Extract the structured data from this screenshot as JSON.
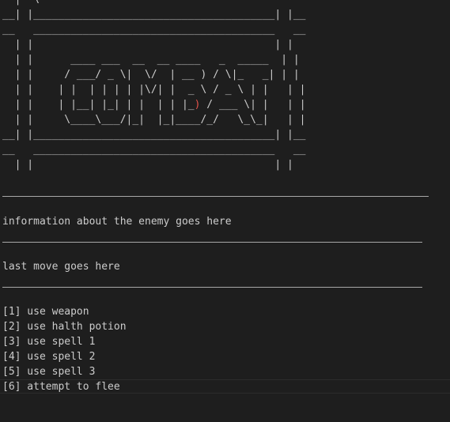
{
  "banner": {
    "row0": "  |  \\",
    "row1": "__| |_______________________________________| |__",
    "row2": "__   _______________________________________   __",
    "row3": "  | |                                       | |",
    "row4": "  | |      ____ ___  __  __ ____   _  _____  | |",
    "row5": "  | |     / ___/ _ \\|  \\/  | __ ) / \\|_   _| | |",
    "row6": "  | |    | |  | | | | |\\/| |  _ \\ / _ \\ | |   | |",
    "row7a": "  | |    | |__| |_| | |  | | |_",
    "row7_red": ")",
    "row7b": " / ___ \\| |   | |",
    "row8": "  | |     \\____\\___/|_|  |_|____/_/   \\_\\_|   | |",
    "row9": "__| |_______________________________________| |__",
    "row10": "__   _______________________________________   __",
    "row11": "  | |                                       | |"
  },
  "enemy_info": "information about the enemy goes here",
  "last_move": "last move goes here",
  "menu": [
    "[1] use weapon",
    "[2] use halth potion",
    "[3] use spell 1",
    "[4] use spell 2",
    "[5] use spell 3",
    "[6] attempt to flee"
  ]
}
